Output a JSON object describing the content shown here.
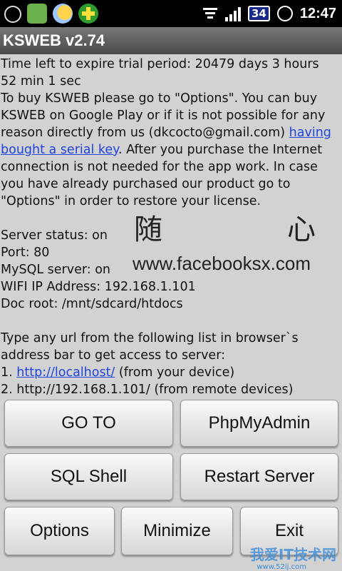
{
  "status_bar": {
    "icons_left": [
      "usb-debug-icon",
      "app-icon",
      "weather-icon",
      "plus-icon"
    ],
    "battery": "34",
    "time": "12:47"
  },
  "app": {
    "title": "KSWEB v2.74"
  },
  "trial": {
    "line1": "Time left to expire trial period: 20479 days 3 hours 52 min 1 sec"
  },
  "buy": {
    "text_before_link": "To buy KSWEB please go to \"Options\". You can buy KSWEB on Google Play or if it is not possible for any reason directly from us (dkcocto@gmail.com) ",
    "link": "having bought a serial key",
    "text_after_link": ". After you purchase the Internet connection is not needed for the app work. In case you have already purchased our product go to \"Options\" in order to restore your license."
  },
  "server": {
    "status": "Server status: on",
    "port": "Port: 80",
    "mysql": "MySQL server: on",
    "wifi": "WIFI IP Address: 192.168.1.101",
    "docroot": "Doc root: /mnt/sdcard/htdocs"
  },
  "watermark": {
    "char1": "随",
    "char2": "心",
    "url": "www.facebooksx.com"
  },
  "urls": {
    "intro": "Type any url from the following list in browser`s address bar to get access to server:",
    "item1_prefix": "1. ",
    "item1_link": "http://localhost/",
    "item1_suffix": " (from your device)",
    "item2": "2. http://192.168.1.101/ (from remote devices)"
  },
  "buttons": {
    "goto": "GO TO",
    "phpmyadmin": "PhpMyAdmin",
    "sqlshell": "SQL Shell",
    "restart": "Restart Server",
    "options": "Options",
    "minimize": "Minimize",
    "exit": "Exit"
  },
  "footer_watermark": {
    "text": "我爱IT技术网",
    "url": "www.52ij.com"
  }
}
